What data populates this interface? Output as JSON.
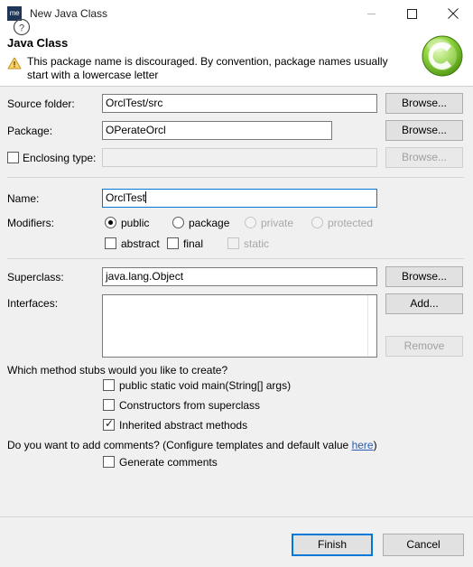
{
  "window": {
    "title": "New Java Class",
    "app_icon": "me",
    "controls": {
      "minimize": "minimize-icon",
      "maximize": "maximize-icon",
      "close": "close-icon"
    }
  },
  "header": {
    "title": "Java Class",
    "warning_icon": "warning-triangle-icon",
    "warning_text": "This package name is discouraged. By convention, package names usually start with a lowercase letter",
    "logo": "green-class-wizard-icon"
  },
  "form": {
    "source_folder": {
      "label": "Source folder:",
      "value": "OrclTest/src",
      "browse": "Browse..."
    },
    "package": {
      "label": "Package:",
      "value": "OPerateOrcl",
      "browse": "Browse..."
    },
    "enclosing_type": {
      "label": "Enclosing type:",
      "checked": false,
      "value": "",
      "browse": "Browse..."
    },
    "name": {
      "label": "Name:",
      "value": "OrclTest",
      "focused": true
    },
    "modifiers": {
      "label": "Modifiers:",
      "radios": [
        {
          "label": "public",
          "selected": true,
          "enabled": true
        },
        {
          "label": "package",
          "selected": false,
          "enabled": true
        },
        {
          "label": "private",
          "selected": false,
          "enabled": false
        },
        {
          "label": "protected",
          "selected": false,
          "enabled": false
        }
      ],
      "checkboxes": [
        {
          "label": "abstract",
          "checked": false,
          "enabled": true
        },
        {
          "label": "final",
          "checked": false,
          "enabled": true
        },
        {
          "label": "static",
          "checked": false,
          "enabled": false
        }
      ]
    },
    "superclass": {
      "label": "Superclass:",
      "value": "java.lang.Object",
      "browse": "Browse..."
    },
    "interfaces": {
      "label": "Interfaces:",
      "items": [],
      "add": "Add...",
      "remove": "Remove",
      "remove_enabled": false
    }
  },
  "stubs": {
    "question": "Which method stubs would you like to create?",
    "options": [
      {
        "label": "public static void main(String[] args)",
        "checked": false
      },
      {
        "label": "Constructors from superclass",
        "checked": false
      },
      {
        "label": "Inherited abstract methods",
        "checked": true
      }
    ]
  },
  "comments": {
    "question_prefix": "Do you want to add comments? (Configure templates and default value ",
    "link": "here",
    "question_suffix": ")",
    "option": {
      "label": "Generate comments",
      "checked": false
    }
  },
  "footer": {
    "help_icon": "help-question-icon",
    "finish": "Finish",
    "cancel": "Cancel"
  },
  "colors": {
    "accent": "#0078d7",
    "dialog_bg": "#f0f0f0",
    "link": "#2a5db0",
    "warning": "#f0b323",
    "logo_green": "#7ac943"
  }
}
